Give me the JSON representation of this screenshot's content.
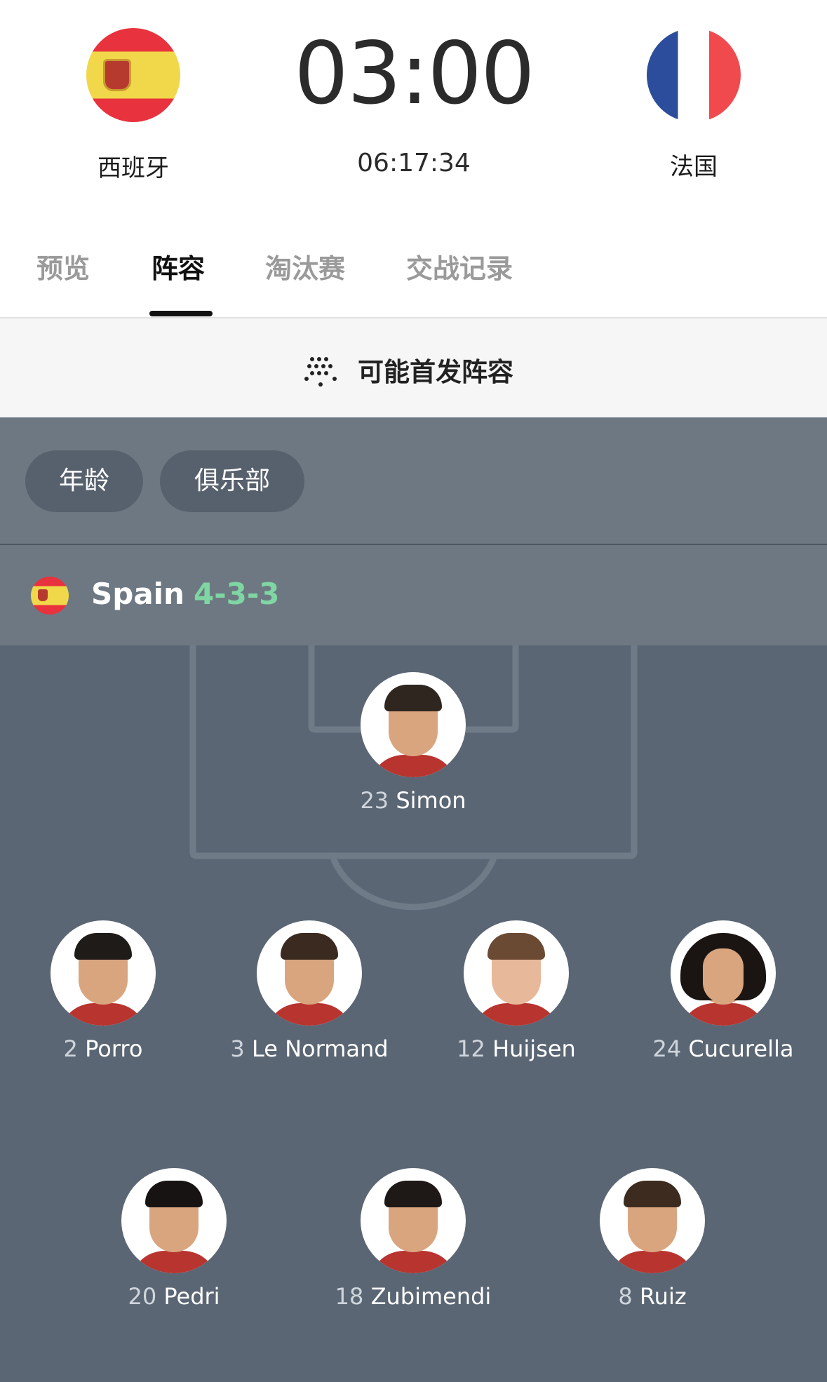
{
  "match": {
    "home_team": "西班牙",
    "away_team": "法国",
    "kickoff_time": "03:00",
    "countdown": "06:17:34"
  },
  "tabs": [
    {
      "label": "预览",
      "active": false
    },
    {
      "label": "阵容",
      "active": true
    },
    {
      "label": "淘汰赛",
      "active": false
    },
    {
      "label": "交战记录",
      "active": false
    }
  ],
  "banner": {
    "label": "可能首发阵容",
    "icon": "formation-dots-icon"
  },
  "filters": [
    {
      "label": "年龄"
    },
    {
      "label": "俱乐部"
    }
  ],
  "lineup": {
    "team": "Spain",
    "formation": "4-3-3",
    "players": [
      {
        "number": "23",
        "name": "Simon"
      },
      {
        "number": "2",
        "name": "Porro"
      },
      {
        "number": "3",
        "name": "Le Normand"
      },
      {
        "number": "12",
        "name": "Huijsen"
      },
      {
        "number": "24",
        "name": "Cucurella"
      },
      {
        "number": "20",
        "name": "Pedri"
      },
      {
        "number": "18",
        "name": "Zubimendi"
      },
      {
        "number": "8",
        "name": "Ruiz"
      }
    ]
  },
  "colors": {
    "accent_formation": "#7fd6a3",
    "pitch": "#5b6674",
    "panel": "#6e7883"
  }
}
